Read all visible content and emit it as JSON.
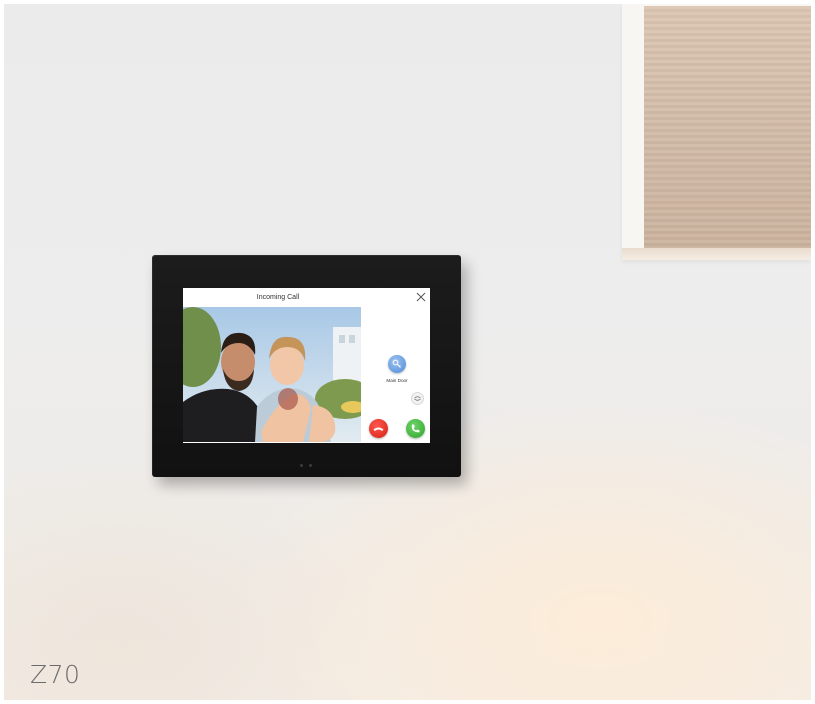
{
  "screen": {
    "title": "Incoming Call",
    "door_label": "Main Door"
  },
  "product": {
    "model": "Z70"
  },
  "icons": {
    "close": "close-icon",
    "door": "key-icon",
    "switch": "camera-switch-icon",
    "hangup": "hangup-icon",
    "answer": "answer-icon"
  },
  "colors": {
    "hangup": "#d51d14",
    "answer": "#2ea52a",
    "door": "#4f89d8",
    "bezel": "#161616"
  }
}
